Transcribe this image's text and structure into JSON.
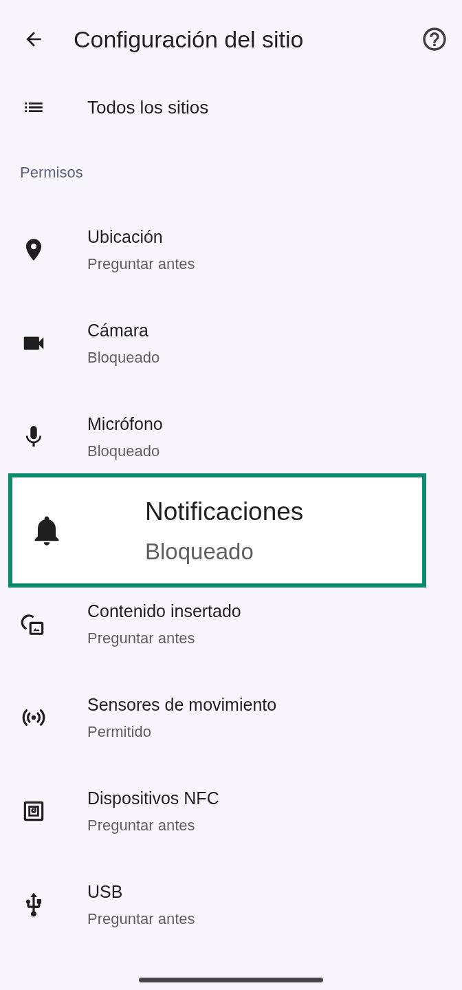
{
  "header": {
    "title": "Configuración del sitio"
  },
  "all_sites": {
    "label": "Todos los sitios"
  },
  "section": {
    "title": "Permisos"
  },
  "permissions": [
    {
      "kind": "location",
      "title": "Ubicación",
      "status": "Preguntar antes",
      "highlighted": false
    },
    {
      "kind": "camera",
      "title": "Cámara",
      "status": "Bloqueado",
      "highlighted": false
    },
    {
      "kind": "microphone",
      "title": "Micrófono",
      "status": "Bloqueado",
      "highlighted": false
    },
    {
      "kind": "notifications",
      "title": "Notificaciones",
      "status": "Bloqueado",
      "highlighted": true
    },
    {
      "kind": "embedded",
      "title": "Contenido insertado",
      "status": "Preguntar antes",
      "highlighted": false
    },
    {
      "kind": "sensors",
      "title": "Sensores de movimiento",
      "status": "Permitido",
      "highlighted": false
    },
    {
      "kind": "nfc",
      "title": "Dispositivos NFC",
      "status": "Preguntar antes",
      "highlighted": false
    },
    {
      "kind": "usb",
      "title": "USB",
      "status": "Preguntar antes",
      "highlighted": false
    }
  ]
}
